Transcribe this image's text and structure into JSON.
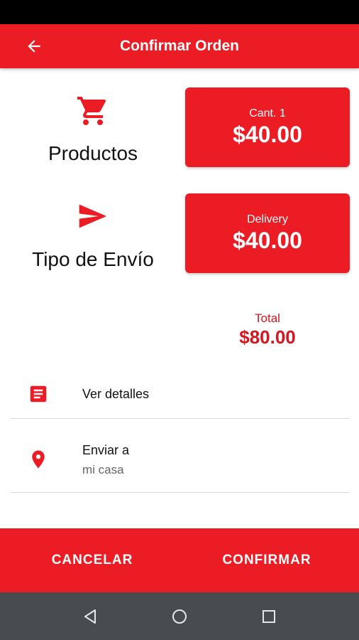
{
  "app_bar": {
    "title": "Confirmar Orden",
    "back_icon": "arrow-back-icon"
  },
  "summary": {
    "products": {
      "label": "Productos",
      "icon": "cart-icon",
      "card_caption": "Cant. 1",
      "card_amount": "$40.00"
    },
    "shipping": {
      "label": "Tipo de Envío",
      "icon": "send-icon",
      "card_caption": "Delivery",
      "card_amount": "$40.00"
    },
    "total_label": "Total",
    "total_value": "$80.00"
  },
  "list": {
    "details": {
      "label": "Ver detalles",
      "icon": "document-icon"
    },
    "send_to": {
      "label": "Enviar a",
      "value": "mi casa",
      "icon": "location-pin-icon"
    }
  },
  "actions": {
    "cancel_label": "CANCELAR",
    "confirm_label": "CONFIRMAR"
  },
  "colors": {
    "accent": "#ec1c24",
    "total_text": "#d8151f",
    "nav_bar": "#484b50"
  }
}
